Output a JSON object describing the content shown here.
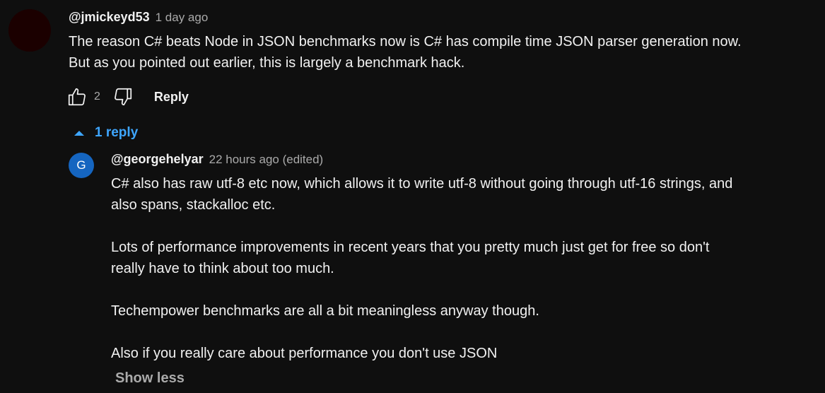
{
  "comment": {
    "author": "@jmickeyd53",
    "time": "1 day ago",
    "text_lines": [
      "The reason C# beats Node in JSON benchmarks now is C# has compile time JSON parser generation now.",
      "But as you pointed out earlier, this is largely a benchmark hack."
    ],
    "like_count": "2",
    "reply_label": "Reply",
    "icons": {
      "avatar": "avatar",
      "like": "thumbs-up-icon",
      "dislike": "thumbs-down-icon"
    },
    "avatar_color": "#1b0000"
  },
  "replies_toggle": {
    "label": "1 reply",
    "icon": "caret-up-icon",
    "color": "#3ea6ff"
  },
  "reply": {
    "author": "@georgehelyar",
    "time": "22 hours ago (edited)",
    "avatar_letter": "G",
    "avatar_color": "#1565c0",
    "paragraphs": [
      {
        "lines": [
          "C# also has raw utf-8 etc now, which allows it to write utf-8 without going through utf-16 strings, and",
          "also spans, stackalloc etc."
        ]
      },
      {
        "lines": [
          "Lots of performance improvements in recent years that you pretty much just get for free so don't",
          "really have to think about too much."
        ]
      },
      {
        "lines": [
          "Techempower benchmarks are all a bit meaningless anyway though."
        ]
      },
      {
        "lines": [
          "Also if you really care about performance you don't use JSON"
        ]
      }
    ],
    "show_less_label": "Show less"
  }
}
